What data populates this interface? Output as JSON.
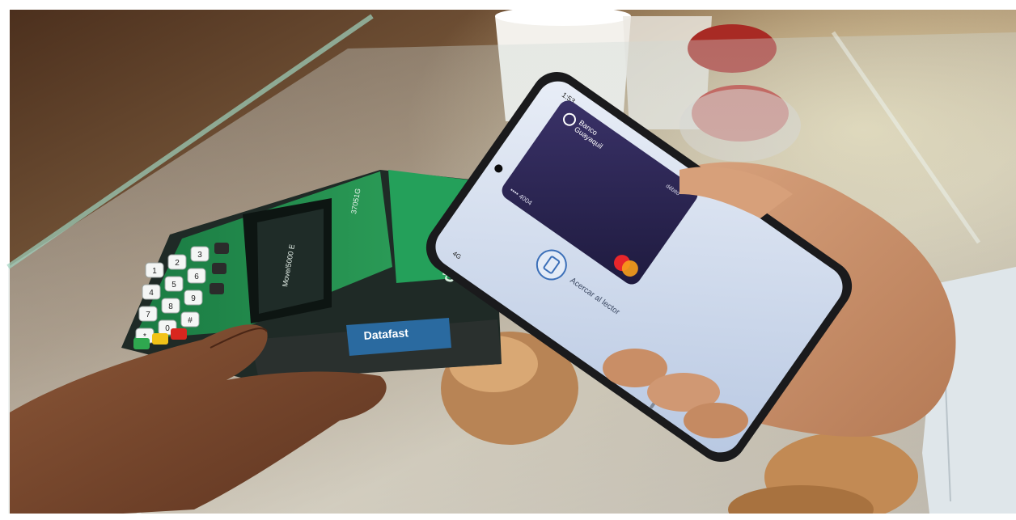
{
  "phone": {
    "status_time": "1:53",
    "status_network": "4G",
    "card_bank": "Banco\nGuayaquil",
    "card_tier": "débito",
    "card_last4": "•••• 4004",
    "prompt": "Acercar al lector"
  },
  "terminal": {
    "brand_label": "Datafast",
    "side_brand": "datafast",
    "model": "Move/5000 E",
    "serial": "37051G",
    "keypad": [
      "1",
      "2",
      "3",
      "4",
      "5",
      "6",
      "7",
      "8",
      "9",
      "*",
      "0",
      "#"
    ]
  },
  "colors": {
    "terminal_green": "#1f8a4c",
    "card_navy": "#2b2552",
    "phone_screen": "#c9d6ea",
    "mastercard_red": "#e8262b",
    "mastercard_orange": "#f79e1b"
  }
}
